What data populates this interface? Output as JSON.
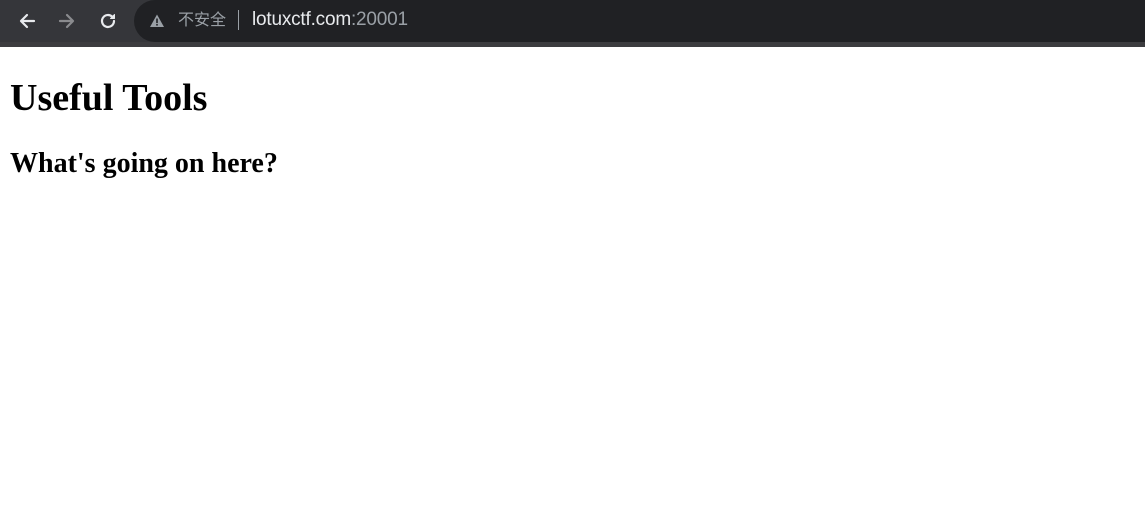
{
  "browser": {
    "security_label": "不安全",
    "url_host": "lotuxctf.com",
    "url_port": ":20001",
    "icons": {
      "back": "back-arrow-icon",
      "forward": "forward-arrow-icon",
      "reload": "reload-icon",
      "security": "warning-triangle-icon"
    },
    "colors": {
      "toolbar": "#35363a",
      "omnibox": "#202124",
      "host_text": "#e8eaed",
      "muted_text": "#9aa0a6"
    }
  },
  "page": {
    "title": "Useful Tools",
    "subtitle": "What's going on here?"
  }
}
